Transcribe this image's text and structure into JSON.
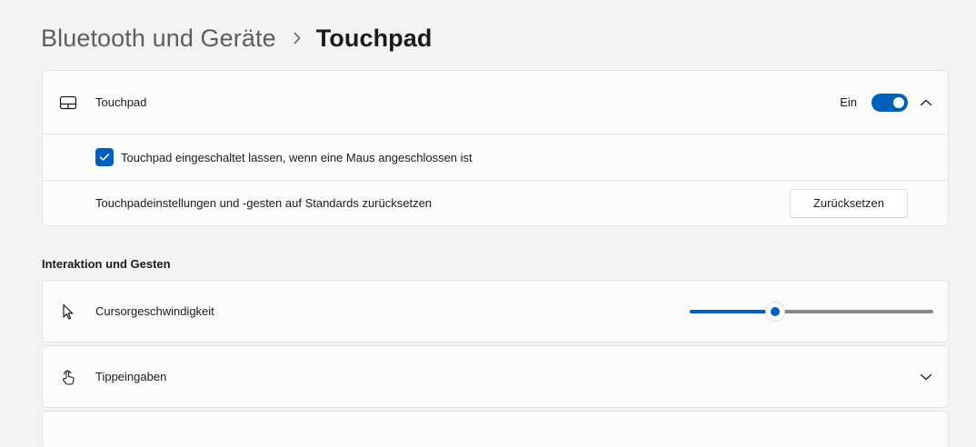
{
  "breadcrumb": {
    "parent": "Bluetooth und Geräte",
    "current": "Touchpad"
  },
  "touchpad_card": {
    "label": "Touchpad",
    "icon": "touchpad-icon",
    "toggle_state": "Ein",
    "toggle_on": true,
    "expanded": true,
    "keep_on_checkbox": {
      "label": "Touchpad eingeschaltet lassen, wenn eine Maus angeschlossen ist",
      "checked": true
    },
    "reset": {
      "label": "Touchpadeinstellungen und -gesten auf Standards zurücksetzen",
      "button_label": "Zurücksetzen"
    }
  },
  "interaction_section": {
    "title": "Interaktion und Gesten",
    "cursor_speed": {
      "label": "Cursorgeschwindigkeit",
      "icon": "cursor-icon",
      "value_fraction": 0.35
    },
    "taps": {
      "label": "Tippeingaben",
      "icon": "tap-gesture-icon",
      "expanded": false
    }
  },
  "colors": {
    "accent": "#005fb8",
    "background": "#f3f3f3",
    "card": "#fbfbfb"
  }
}
